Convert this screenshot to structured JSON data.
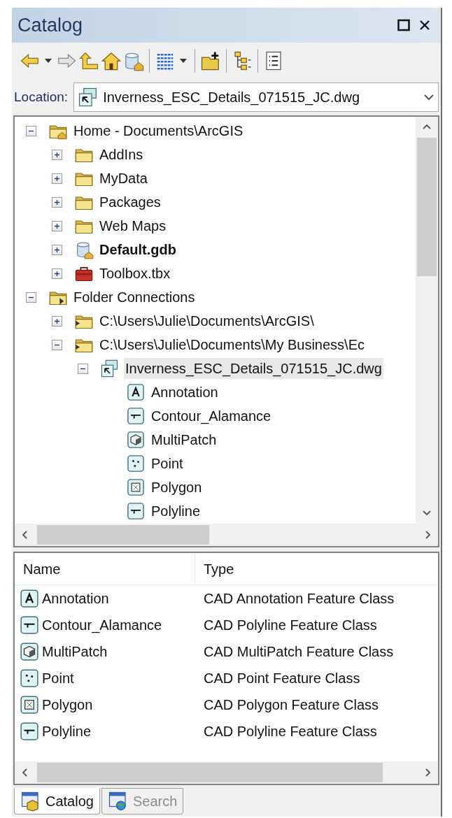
{
  "panel": {
    "title": "Catalog"
  },
  "location": {
    "label": "Location:",
    "value": "Inverness_ESC_Details_071515_JC.dwg"
  },
  "tree": [
    {
      "kind": "home_folder",
      "label": "Home - Documents\\ArcGIS",
      "expanded": true,
      "selected": false,
      "is_default": false,
      "children": [
        {
          "kind": "folder",
          "label": "AddIns",
          "expanded": false,
          "selected": false,
          "is_default": false
        },
        {
          "kind": "folder",
          "label": "MyData",
          "expanded": false,
          "selected": false,
          "is_default": false
        },
        {
          "kind": "folder",
          "label": "Packages",
          "expanded": false,
          "selected": false,
          "is_default": false
        },
        {
          "kind": "folder",
          "label": "Web Maps",
          "expanded": false,
          "selected": false,
          "is_default": false
        },
        {
          "kind": "geodatabase",
          "label": "Default.gdb",
          "expanded": false,
          "selected": false,
          "is_default": true
        },
        {
          "kind": "toolbox",
          "label": "Toolbox.tbx",
          "expanded": false,
          "selected": false,
          "is_default": false
        }
      ]
    },
    {
      "kind": "folder_connections",
      "label": "Folder Connections",
      "expanded": true,
      "selected": false,
      "is_default": false,
      "children": [
        {
          "kind": "connected_folder",
          "label": "C:\\Users\\Julie\\Documents\\ArcGIS\\",
          "expanded": false,
          "selected": false,
          "is_default": false
        },
        {
          "kind": "connected_folder",
          "label": "C:\\Users\\Julie\\Documents\\My Business\\Ec",
          "expanded": true,
          "selected": false,
          "is_default": false,
          "children": [
            {
              "kind": "cad_drawing",
              "label": "Inverness_ESC_Details_071515_JC.dwg",
              "expanded": true,
              "selected": true,
              "is_default": false,
              "children": [
                {
                  "kind": "annotation",
                  "label": "Annotation",
                  "selected": false,
                  "is_default": false
                },
                {
                  "kind": "polyline",
                  "label": "Contour_Alamance",
                  "selected": false,
                  "is_default": false
                },
                {
                  "kind": "multipatch",
                  "label": "MultiPatch",
                  "selected": false,
                  "is_default": false
                },
                {
                  "kind": "point",
                  "label": "Point",
                  "selected": false,
                  "is_default": false
                },
                {
                  "kind": "polygon",
                  "label": "Polygon",
                  "selected": false,
                  "is_default": false
                },
                {
                  "kind": "polyline",
                  "label": "Polyline",
                  "selected": false,
                  "is_default": false
                }
              ]
            }
          ]
        }
      ]
    }
  ],
  "table": {
    "columns": [
      "Name",
      "Type"
    ],
    "rows": [
      {
        "kind": "annotation",
        "name": "Annotation",
        "type": "CAD Annotation Feature Class"
      },
      {
        "kind": "polyline",
        "name": "Contour_Alamance",
        "type": "CAD Polyline Feature Class"
      },
      {
        "kind": "multipatch",
        "name": "MultiPatch",
        "type": "CAD MultiPatch Feature Class"
      },
      {
        "kind": "point",
        "name": "Point",
        "type": "CAD Point Feature Class"
      },
      {
        "kind": "polygon",
        "name": "Polygon",
        "type": "CAD Polygon Feature Class"
      },
      {
        "kind": "polyline",
        "name": "Polyline",
        "type": "CAD Polyline Feature Class"
      }
    ]
  },
  "tabs": [
    {
      "kind": "catalog",
      "label": "Catalog",
      "selected": true
    },
    {
      "kind": "search",
      "label": "Search",
      "selected": false
    }
  ]
}
